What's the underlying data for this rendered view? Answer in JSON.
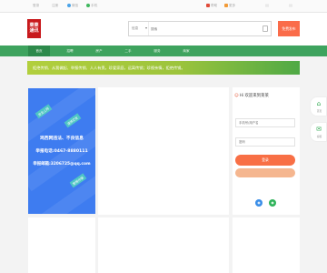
{
  "topbar": {
    "items": [
      "登录",
      "注册",
      "微信",
      "手机",
      "帮助",
      "更多"
    ],
    "colors": {
      "water": "#4aa3e8",
      "wechat": "#3fb75d",
      "phone": "#e04b3a",
      "flag": "#f29b38"
    }
  },
  "header": {
    "logo_lines": [
      "莱莱",
      "通讯"
    ],
    "search": {
      "category": "信息",
      "placeholder": "搜索"
    },
    "post_button": "免费发布"
  },
  "nav": {
    "items": [
      "首页",
      "招聘",
      "房产",
      "二手",
      "服务",
      "商家"
    ]
  },
  "notice": {
    "text": "拒绝传销、从我做起、举报传销、人人有责。珍爱家庭，远离传销；珍视亲情，拒绝传销。"
  },
  "ad": {
    "chips": [
      "安全上网",
      "谨慎交友",
      "警惕诈骗"
    ],
    "headline": "鸡西网违法、不良信息",
    "phone": "举报电话:0467-8880111",
    "email": "举报邮箱:3206725@qq.com"
  },
  "side": {
    "greeting": "Hi 欢迎来到莱莱",
    "username_placeholder": "手机号/用户名",
    "password_placeholder": "密码",
    "login_label": "登录",
    "social": [
      "qq-icon",
      "wechat-icon"
    ]
  },
  "float": {
    "items": [
      {
        "icon": "home-icon",
        "label": "首页"
      },
      {
        "icon": "chat-icon",
        "label": "客服"
      }
    ]
  }
}
